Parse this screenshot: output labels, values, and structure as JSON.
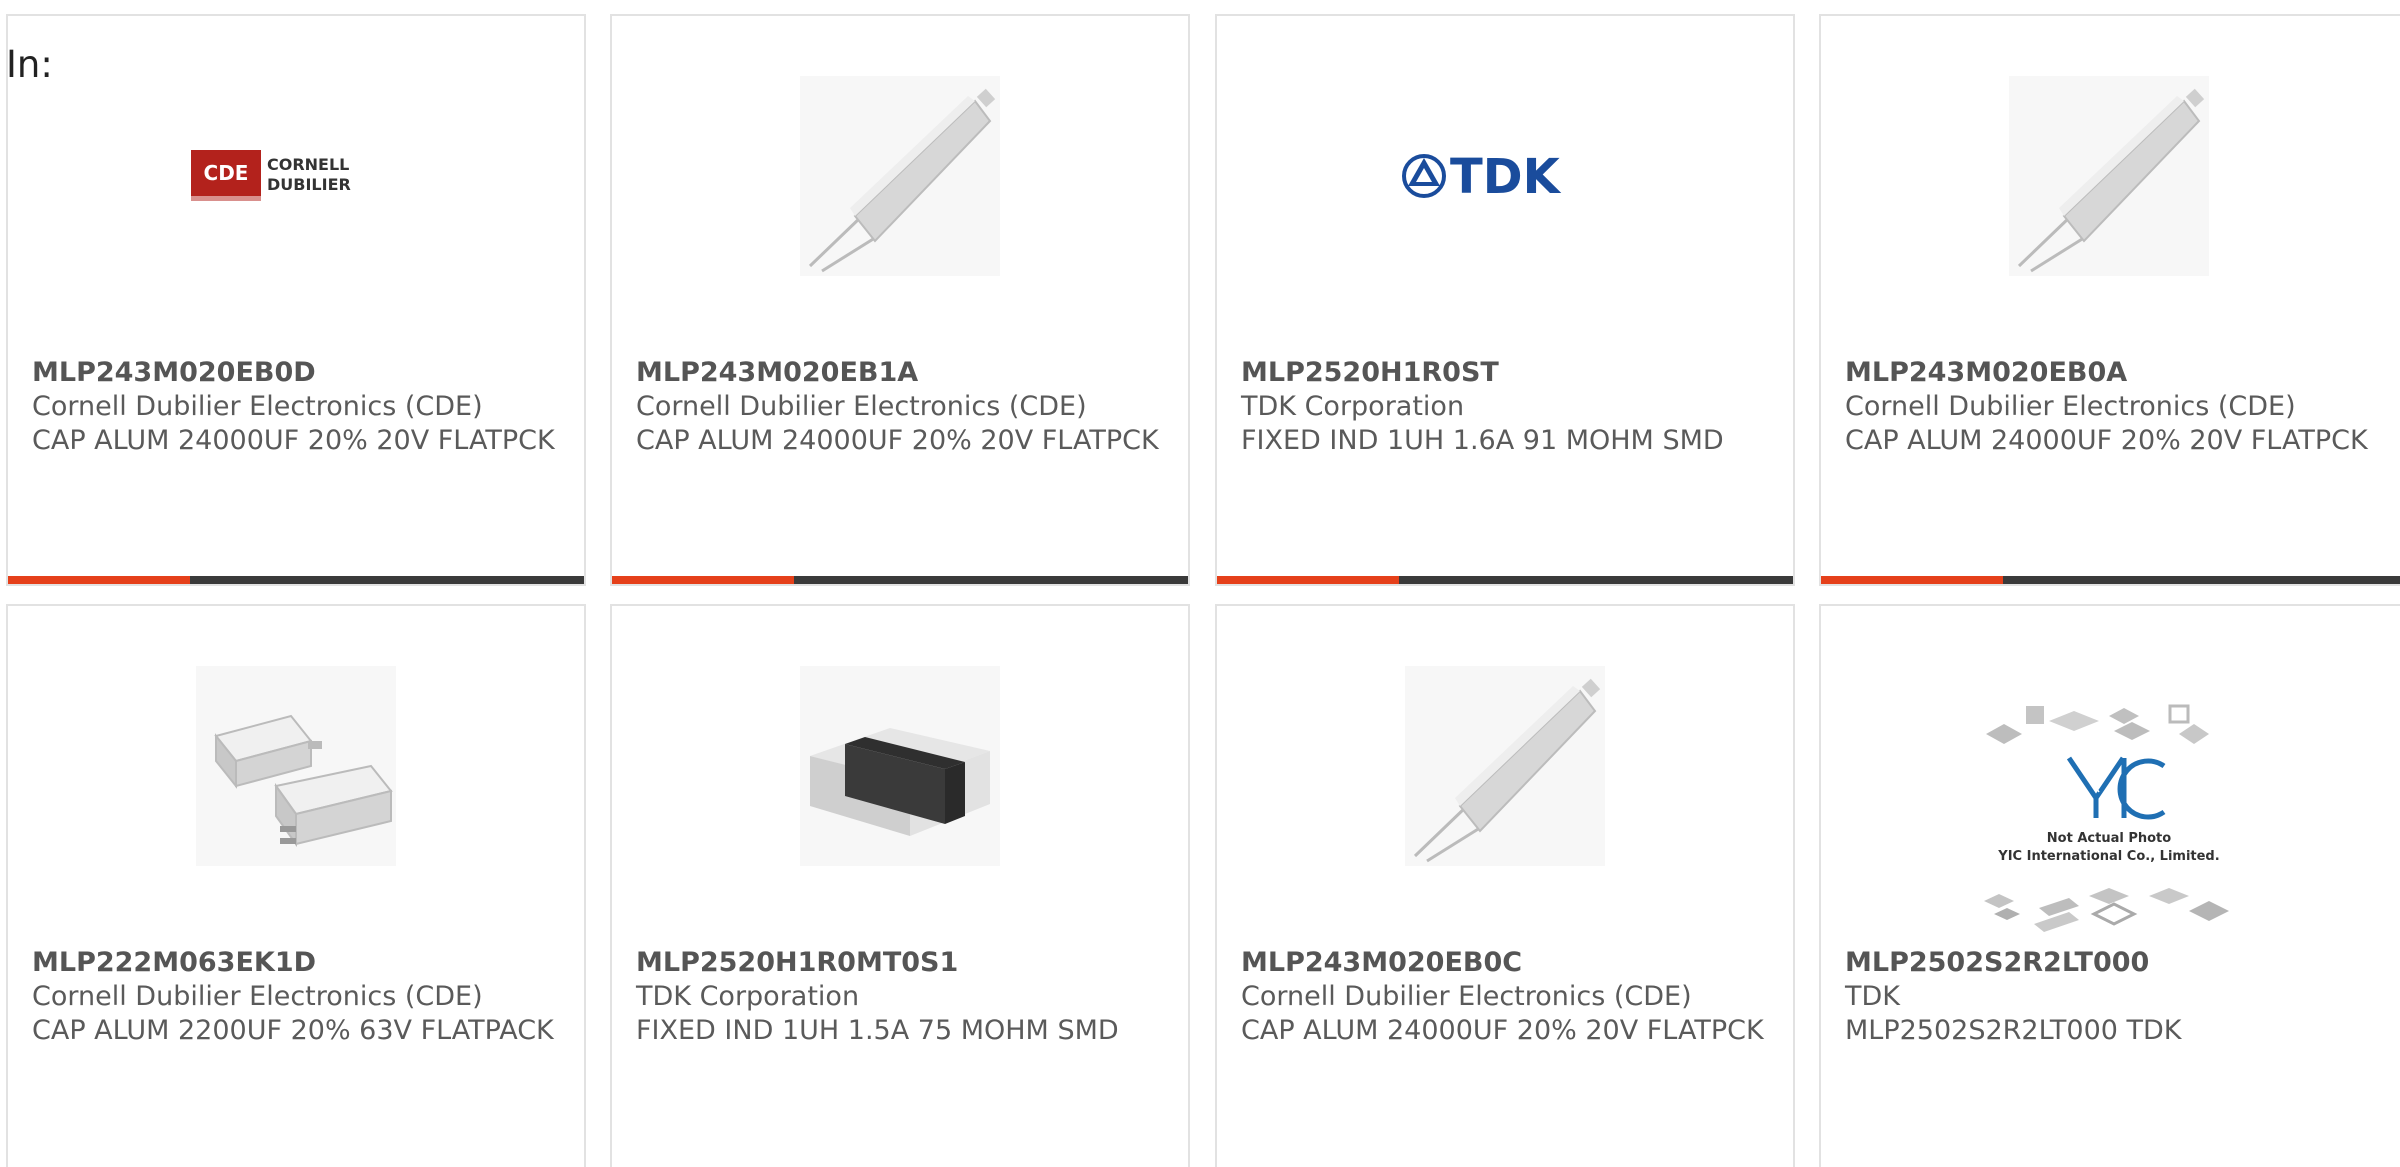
{
  "header": {
    "label": "In:"
  },
  "colors": {
    "accent": "#e5401a",
    "bar": "#3a3a3a",
    "border": "#e2e2e2",
    "text": "#5a5a5a"
  },
  "products": [
    {
      "part": "MLP243M020EB0D",
      "manufacturer": "Cornell Dubilier Electronics (CDE)",
      "description": "CAP ALUM 24000UF 20% 20V FLATPCK",
      "image": "cde-logo-icon"
    },
    {
      "part": "MLP243M020EB1A",
      "manufacturer": "Cornell Dubilier Electronics (CDE)",
      "description": "CAP ALUM 24000UF 20% 20V FLATPCK",
      "image": "flatpack-capacitor-icon"
    },
    {
      "part": "MLP2520H1R0ST",
      "manufacturer": "TDK Corporation",
      "description": "FIXED IND 1UH 1.6A 91 MOHM SMD",
      "image": "tdk-logo-icon",
      "logo_text": "TDK"
    },
    {
      "part": "MLP243M020EB0A",
      "manufacturer": "Cornell Dubilier Electronics (CDE)",
      "description": "CAP ALUM 24000UF 20% 20V FLATPCK",
      "image": "flatpack-capacitor-icon"
    },
    {
      "part": "MLP222M063EK1D",
      "manufacturer": "Cornell Dubilier Electronics (CDE)",
      "description": "CAP ALUM 2200UF 20% 63V FLATPACK",
      "image": "dual-flatpack-capacitor-icon"
    },
    {
      "part": "MLP2520H1R0MT0S1",
      "manufacturer": "TDK Corporation",
      "description": "FIXED IND 1UH 1.5A 75 MOHM SMD",
      "image": "smd-inductor-icon"
    },
    {
      "part": "MLP243M020EB0C",
      "manufacturer": "Cornell Dubilier Electronics (CDE)",
      "description": "CAP ALUM 24000UF 20% 20V FLATPCK",
      "image": "flatpack-capacitor-icon"
    },
    {
      "part": "MLP2502S2R2LT000",
      "manufacturer": "TDK",
      "description": "MLP2502S2R2LT000 TDK",
      "image": "not-actual-photo-icon",
      "placeholder_lines": [
        "Not Actual Photo",
        "YIC International Co., Limited."
      ]
    }
  ]
}
